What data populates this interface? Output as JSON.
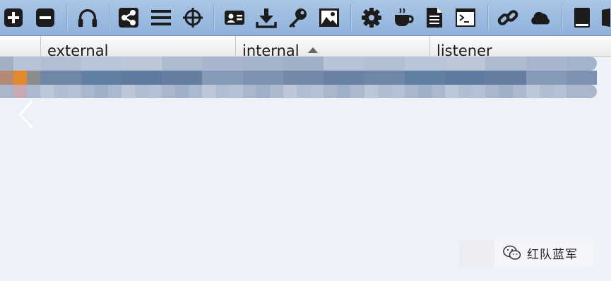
{
  "toolbar": {
    "buttons": [
      {
        "icon": "plus-icon"
      },
      {
        "icon": "minus-icon"
      },
      {
        "icon": "headphones-icon"
      },
      {
        "icon": "share-icon"
      },
      {
        "icon": "list-icon"
      },
      {
        "icon": "crosshair-icon"
      },
      {
        "icon": "id-card-icon"
      },
      {
        "icon": "download-icon"
      },
      {
        "icon": "key-icon"
      },
      {
        "icon": "image-icon"
      },
      {
        "icon": "gear-icon"
      },
      {
        "icon": "coffee-cup-icon"
      },
      {
        "icon": "document-icon"
      },
      {
        "icon": "terminal-icon"
      },
      {
        "icon": "link-icon"
      },
      {
        "icon": "cloud-icon"
      },
      {
        "icon": "book-icon"
      }
    ]
  },
  "table": {
    "columns": [
      {
        "label": ""
      },
      {
        "label": "external"
      },
      {
        "label": "internal",
        "sorted": "ascending"
      },
      {
        "label": "listener"
      }
    ]
  },
  "colors": {
    "toolbar_top": "#aac6e6",
    "toolbar_bottom": "#8fb1db",
    "background": "#eef1f8",
    "row_highlight": "#5f7fa3",
    "orange_cell": "#e08a2c"
  },
  "watermark": {
    "text": "红队蓝军"
  }
}
